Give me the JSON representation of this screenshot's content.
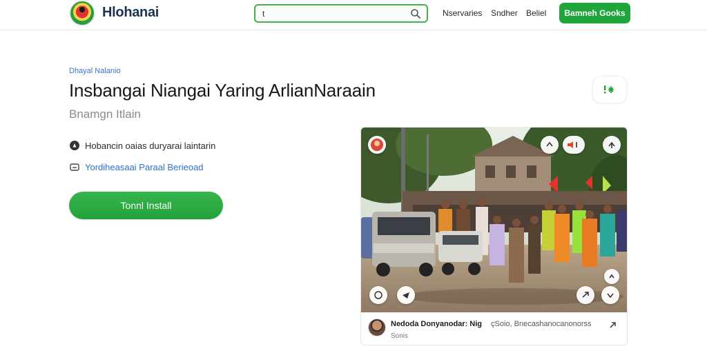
{
  "header": {
    "brand": "Hlohanai",
    "search": {
      "value": "t"
    },
    "nav": [
      "Nservaries",
      "Sndher",
      "Beliel"
    ],
    "cta_label": "Bamneh Gooks"
  },
  "main": {
    "breadcrumb": "Dhayal Nalanio",
    "title": "Insbangai Niangai Yaring ArlianNaraain",
    "subtitle": "Bnamgn Itlain",
    "meta": [
      {
        "icon": "info-icon",
        "text": "Hobancin oaias duryarai laintarin"
      },
      {
        "icon": "link-icon",
        "text": "Yordiheasaai Paraal Berieoad"
      }
    ],
    "install_label": "Tonnl Install"
  },
  "card": {
    "author": "Nedoda Donyanodar: Nig",
    "description": "çSoio, Bnecashanocanonorss",
    "sub": "Sonis"
  },
  "colors": {
    "accent": "#1fa53a",
    "link": "#2e6fd0",
    "brand_text": "#1b3354"
  }
}
